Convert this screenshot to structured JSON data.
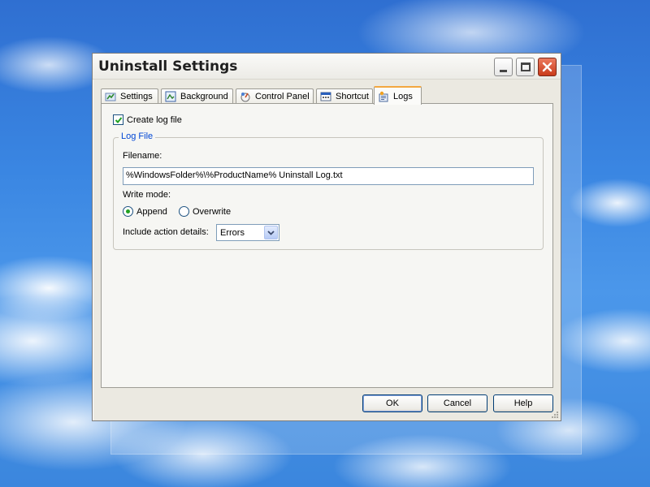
{
  "window": {
    "title": "Uninstall Settings"
  },
  "tabs": [
    {
      "label": "Settings",
      "icon": "settings-icon"
    },
    {
      "label": "Background",
      "icon": "background-icon"
    },
    {
      "label": "Control Panel",
      "icon": "control-panel-icon"
    },
    {
      "label": "Shortcut",
      "icon": "shortcut-icon"
    },
    {
      "label": "Logs",
      "icon": "logs-icon",
      "active": true
    }
  ],
  "logs": {
    "create_log_label": "Create log file",
    "create_log_checked": true,
    "group_title": "Log File",
    "filename_label": "Filename:",
    "filename_value": "%WindowsFolder%\\%ProductName% Uninstall Log.txt",
    "write_mode_label": "Write mode:",
    "write_mode_options": [
      "Append",
      "Overwrite"
    ],
    "write_mode_selected": "Append",
    "action_details_label": "Include action details:",
    "action_details_value": "Errors"
  },
  "buttons": {
    "ok": "OK",
    "cancel": "Cancel",
    "help": "Help"
  },
  "colors": {
    "group_title": "#0046d5",
    "active_tab_accent": "#f3a740",
    "radio_selected": "#21a121"
  }
}
